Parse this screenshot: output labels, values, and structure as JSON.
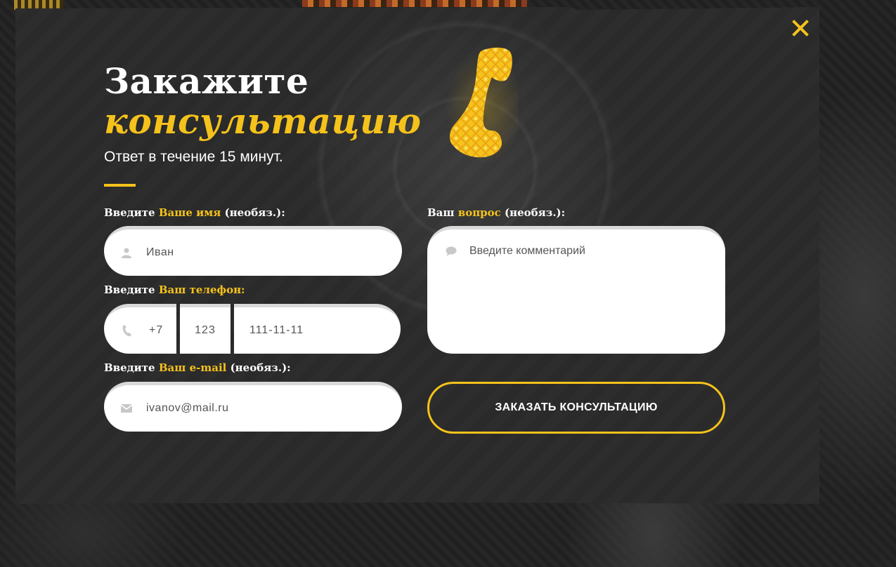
{
  "modal": {
    "title_line1": "Закажите",
    "title_line2": "консультацию",
    "subtitle": "Ответ в течение 15 минут.",
    "close_icon": "close-x-icon",
    "accent_color": "#f5c21b"
  },
  "form": {
    "name": {
      "label_prefix": "Введите",
      "label_highlight": "Ваше имя",
      "label_suffix": "(необяз.):",
      "placeholder": "Иван",
      "icon": "user-icon"
    },
    "phone": {
      "label_prefix": "Введите",
      "label_highlight": "Ваш телефон:",
      "country_code": "+7",
      "area_code": "123",
      "number": "111-11-11",
      "icon": "phone-icon"
    },
    "email": {
      "label_prefix": "Введите",
      "label_highlight": "Ваш e-mail",
      "label_suffix": "(необяз.):",
      "placeholder": "ivanov@mail.ru",
      "icon": "mail-icon"
    },
    "question": {
      "label_prefix": "Ваш",
      "label_highlight": "вопрос",
      "label_suffix": "(необяз.):",
      "placeholder": "Введите комментарий",
      "icon": "comment-icon"
    },
    "submit_label": "ЗАКАЗАТЬ КОНСУЛЬТАЦИЮ"
  }
}
